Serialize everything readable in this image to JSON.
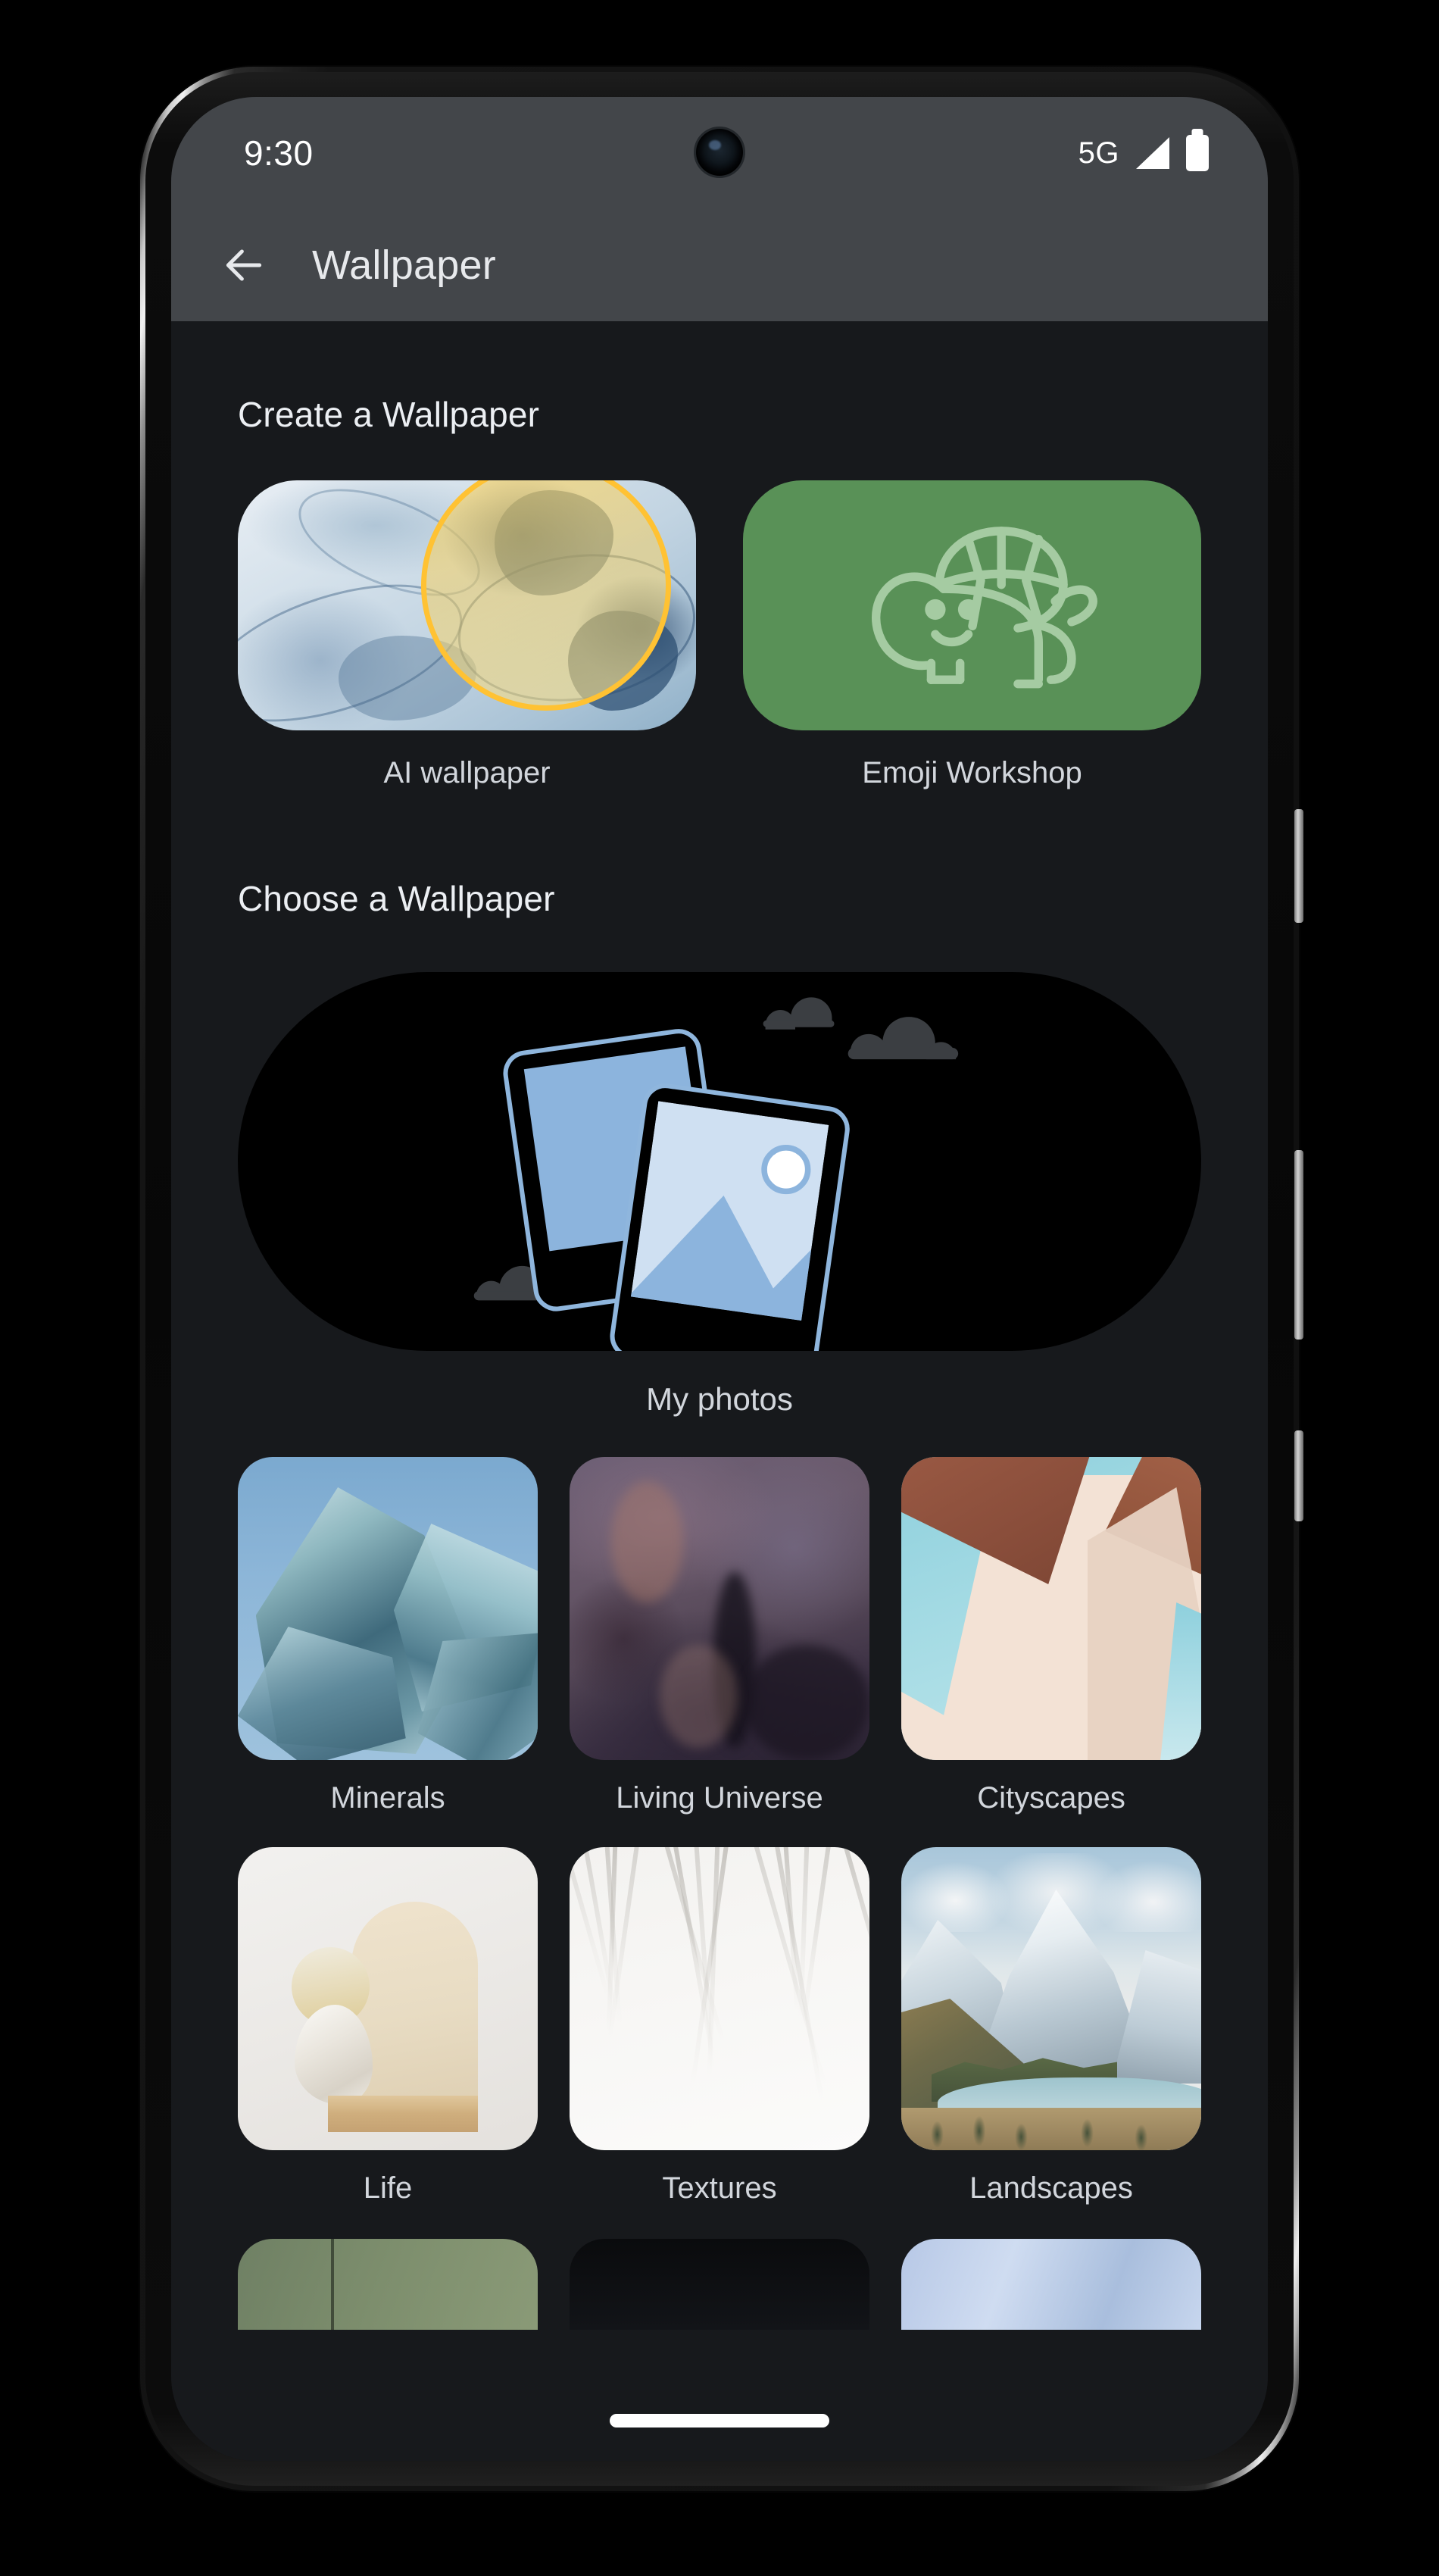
{
  "status_bar": {
    "time": "9:30",
    "network_label": "5G",
    "signal_icon": "signal-bars-icon",
    "battery_icon": "battery-full-icon",
    "background_color": "#43464a"
  },
  "app_bar": {
    "back_icon": "back-arrow-icon",
    "title": "Wallpaper",
    "background_color": "#43464a"
  },
  "create_section": {
    "heading": "Create a Wallpaper",
    "items": [
      {
        "label": "AI wallpaper",
        "icon": "ai-wallpaper-thumbnail",
        "accent_color": "#ffc233"
      },
      {
        "label": "Emoji Workshop",
        "icon": "turtle-emoji-icon",
        "accent_color": "#599157"
      }
    ]
  },
  "choose_section": {
    "heading": "Choose a Wallpaper",
    "my_photos": {
      "label": "My photos",
      "icon": "photo-stack-illustration",
      "background_color": "#000000"
    },
    "categories": [
      {
        "label": "Minerals",
        "icon": "minerals-thumbnail"
      },
      {
        "label": "Living Universe",
        "icon": "living-universe-thumbnail"
      },
      {
        "label": "Cityscapes",
        "icon": "cityscapes-thumbnail"
      },
      {
        "label": "Life",
        "icon": "life-thumbnail"
      },
      {
        "label": "Textures",
        "icon": "textures-thumbnail"
      },
      {
        "label": "Landscapes",
        "icon": "landscapes-thumbnail"
      }
    ]
  },
  "navigation": {
    "gesture_bar": "home-gesture-indicator"
  },
  "theme": {
    "screen_background": "#17191c",
    "bar_background": "#43464a",
    "primary_text": "#eceff3",
    "secondary_text": "#d2d6dc"
  }
}
